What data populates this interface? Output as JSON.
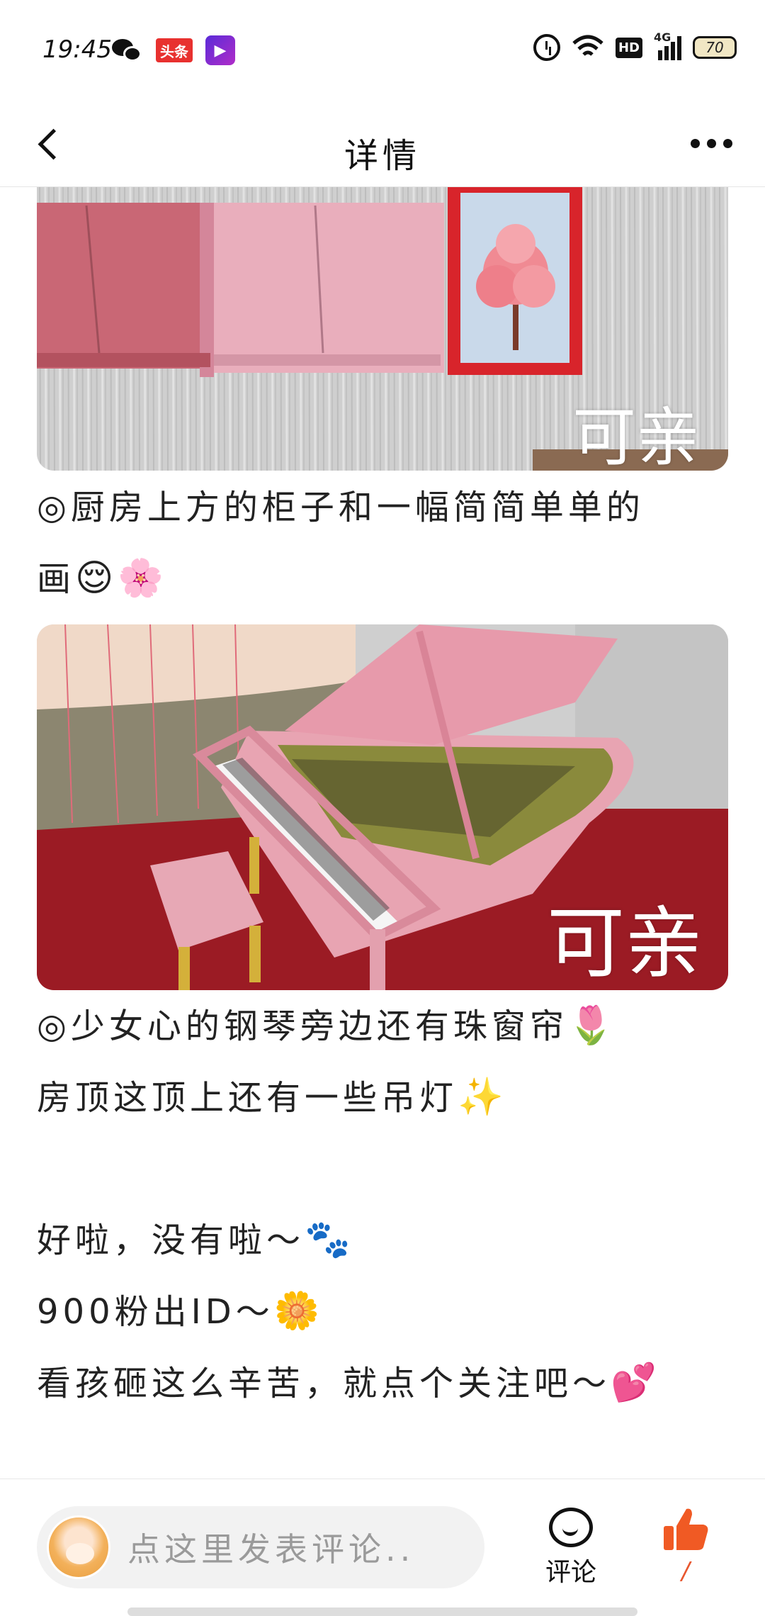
{
  "status_bar": {
    "time": "19:45",
    "app_badge": "头条",
    "network": "4G",
    "hd": "HD",
    "battery": "70"
  },
  "nav": {
    "title": "详情"
  },
  "images": [
    {
      "watermark": "可亲"
    },
    {
      "watermark": "可亲"
    }
  ],
  "captions": {
    "cabinet_line1": "◎厨房上方的柜子和一幅简简单单的",
    "cabinet_line2": "画",
    "cabinet_emoji": "😌🌸",
    "piano_line1": "◎少女心的钢琴旁边还有珠窗帘",
    "piano_line1_emoji": "🌷",
    "piano_line2": "房顶这顶上还有一些吊灯",
    "piano_line2_emoji": "✨",
    "end_line1": "好啦，没有啦～",
    "end_line1_emoji": "🐾",
    "end_line2": "900粉出ID～",
    "end_line2_emoji": "🌼",
    "end_line3": "看孩砸这么辛苦，就点个关注吧～",
    "end_line3_emoji": "💕"
  },
  "bottom_bar": {
    "comment_placeholder": "点这里发表评论..",
    "comment_label": "评论",
    "like_count": "/",
    "like_color": "#f05a24"
  }
}
